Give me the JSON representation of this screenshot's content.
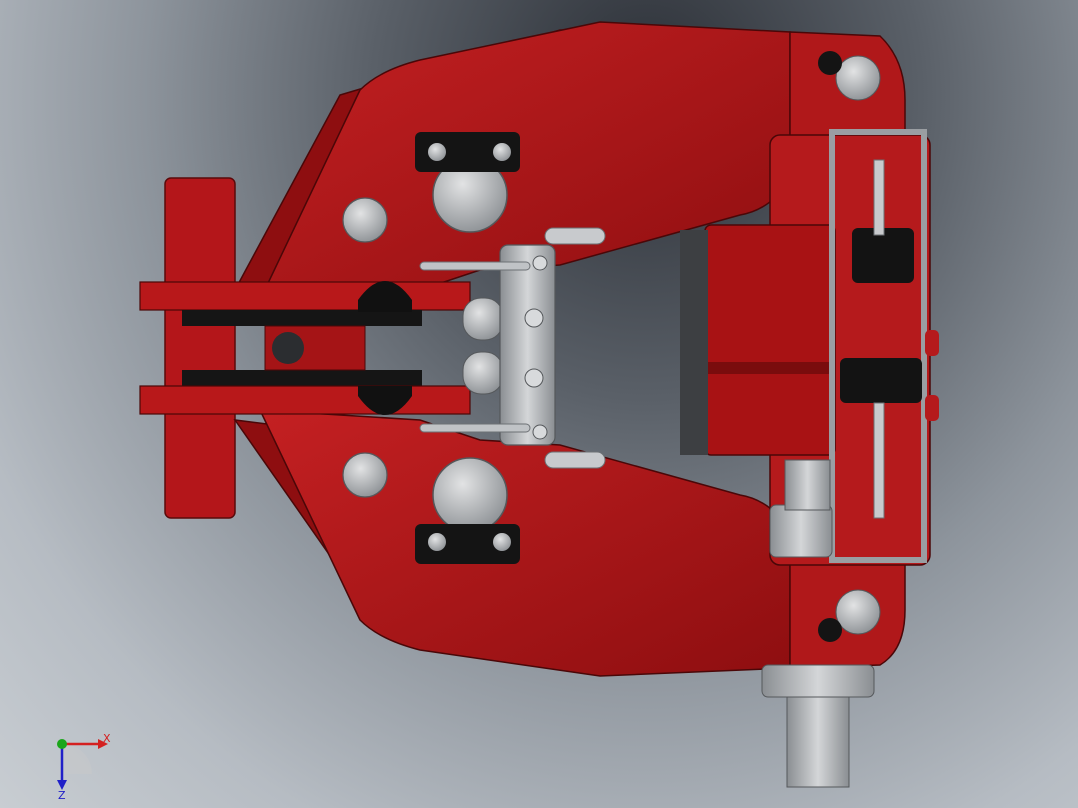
{
  "viewport": {
    "background_top": "#2a2e35",
    "background_bottom": "#c8cdd2"
  },
  "model": {
    "colors": {
      "body_red": "#a81214",
      "body_red_dark": "#6e0c0d",
      "body_red_light": "#c8282a",
      "steel": "#b9bcbf",
      "steel_dark": "#7f8387",
      "black_part": "#111111"
    },
    "icon": "disc-brake-caliper-3d-model"
  },
  "triad": {
    "x_label": "X",
    "z_label": "Z",
    "x_color": "#d42020",
    "y_color": "#1aa61a",
    "z_color": "#2020c8",
    "icon": "coordinate-triad-icon"
  }
}
